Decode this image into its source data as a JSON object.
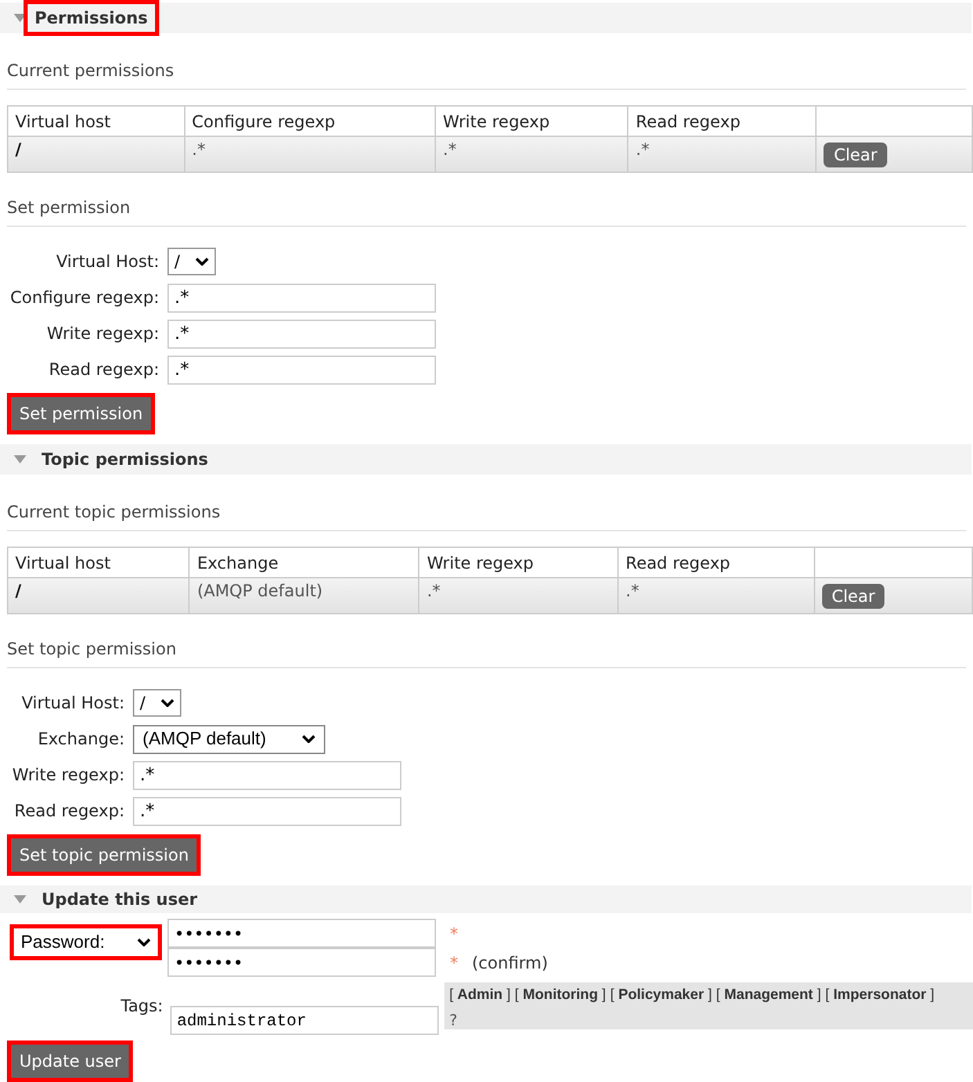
{
  "permissions": {
    "title": "Permissions",
    "highlighted": true,
    "current": {
      "heading": "Current permissions",
      "columns": [
        "Virtual host",
        "Configure regexp",
        "Write regexp",
        "Read regexp"
      ],
      "rows": [
        {
          "cells": [
            "/",
            ".*",
            ".*",
            ".*"
          ],
          "button": "Clear"
        }
      ]
    },
    "set": {
      "heading": "Set permission",
      "fields": [
        {
          "kind": "select",
          "label": "Virtual Host:",
          "value": "/"
        },
        {
          "kind": "text",
          "label": "Configure regexp:",
          "value": ".*"
        },
        {
          "kind": "text",
          "label": "Write regexp:",
          "value": ".*"
        },
        {
          "kind": "text",
          "label": "Read regexp:",
          "value": ".*"
        }
      ],
      "button": {
        "label": "Set permission",
        "highlighted": true
      }
    }
  },
  "topic_permissions": {
    "title": "Topic permissions",
    "highlighted": false,
    "current": {
      "heading": "Current topic permissions",
      "columns": [
        "Virtual host",
        "Exchange",
        "Write regexp",
        "Read regexp"
      ],
      "rows": [
        {
          "cells": [
            "/",
            "(AMQP default)",
            ".*",
            ".*"
          ],
          "button": "Clear"
        }
      ]
    },
    "set": {
      "heading": "Set topic permission",
      "fields": [
        {
          "kind": "select",
          "label": "Virtual Host:",
          "value": "/"
        },
        {
          "kind": "wide_select",
          "label": "Exchange:",
          "value": "(AMQP default)"
        },
        {
          "kind": "text",
          "label": "Write regexp:",
          "value": ".*"
        },
        {
          "kind": "text",
          "label": "Read regexp:",
          "value": ".*"
        }
      ],
      "button": {
        "label": "Set topic permission",
        "highlighted": true
      }
    }
  },
  "update_user": {
    "title": "Update this user",
    "highlighted": false,
    "password_select": {
      "value": "Password:",
      "highlighted": true
    },
    "password": {
      "value": "•••••••",
      "required_mark": "*"
    },
    "confirm": {
      "value": "•••••••",
      "required_mark": "*",
      "note": "(confirm)"
    },
    "tags": {
      "label": "Tags:",
      "value": "administrator",
      "options": [
        "[ **Admin** ]",
        "[ **Monitoring** ]",
        "[ **Policymaker** ]",
        "[ **Management** ]",
        "[ **Impersonator** ]"
      ],
      "help": "?"
    },
    "button": {
      "label": "Update user",
      "highlighted": true
    }
  }
}
